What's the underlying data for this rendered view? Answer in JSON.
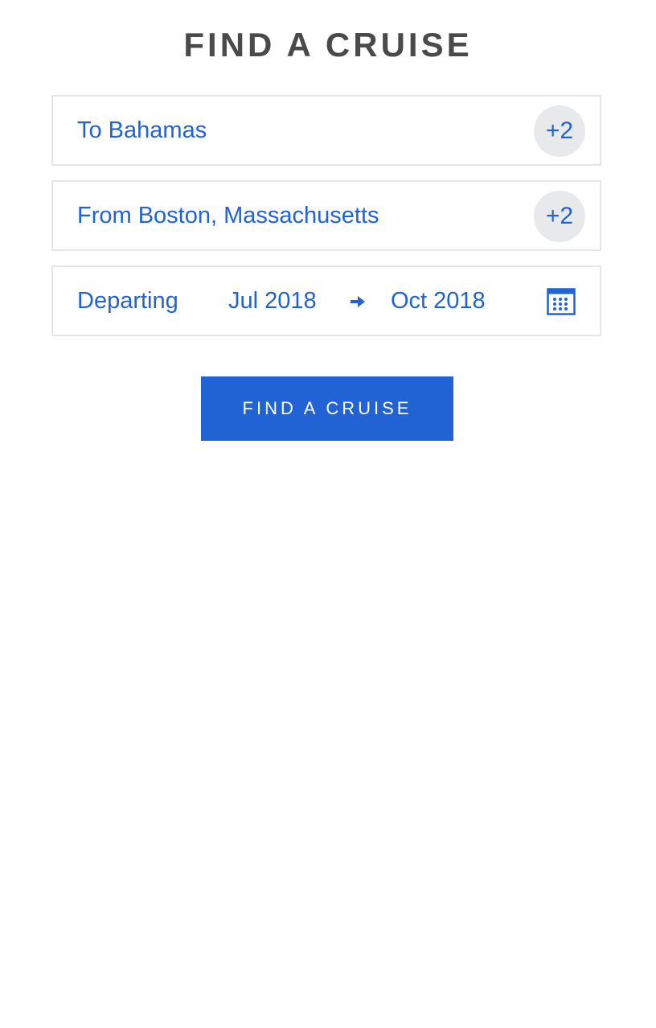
{
  "page": {
    "title": "FIND A CRUISE"
  },
  "destination": {
    "label": "To Bahamas",
    "extra_count": "+2"
  },
  "departure_port": {
    "label": "From Boston, Massachusetts",
    "extra_count": "+2"
  },
  "dates": {
    "label": "Departing",
    "start": "Jul 2018",
    "end": "Oct 2018",
    "arrow_icon": "arrow-right-icon",
    "calendar_icon": "calendar-icon"
  },
  "search_button": {
    "label": "FIND A CRUISE"
  },
  "colors": {
    "accent": "#2162d4",
    "title": "#4a4a4a",
    "border": "#e6e6e6",
    "badge_bg": "#e8e9eb"
  }
}
